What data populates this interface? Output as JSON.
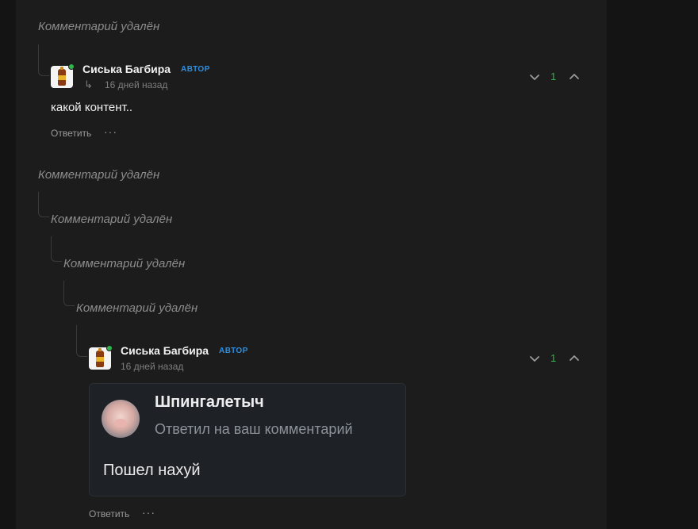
{
  "deleted_label": "Комментарий удалён",
  "comments": [
    {
      "author": "Сиська Багбира",
      "badge": "АВТОР",
      "reply_icon": "reply-arrow-icon",
      "time": "16 дней назад",
      "text": "какой контент..",
      "votes": "1",
      "reply_label": "Ответить",
      "more_label": "···"
    },
    {
      "author": "Сиська Багбира",
      "badge": "АВТОР",
      "time": "16 дней назад",
      "votes": "1",
      "reply_label": "Ответить",
      "more_label": "···",
      "embed": {
        "name": "Шпингалетыч",
        "subtitle": "Ответил на ваш комментарий",
        "message": "Пошел нахуй"
      }
    }
  ],
  "colors": {
    "background": "#141414",
    "panel": "#1c1c1c",
    "badge": "#2e8fe0",
    "votes_positive": "#2fb54a",
    "online": "#2fb54a"
  }
}
